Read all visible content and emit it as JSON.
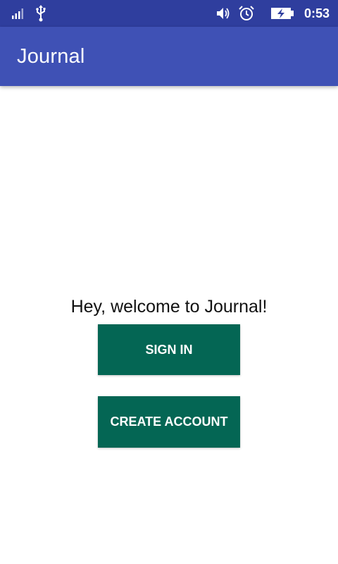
{
  "status_bar": {
    "time": "0:53",
    "icons": [
      "signal-icon",
      "usb-icon",
      "volume-icon",
      "alarm-icon",
      "battery-charging-icon"
    ],
    "background_color": "#2f3e9e"
  },
  "app_bar": {
    "title": "Journal",
    "background_color": "#3f51b5"
  },
  "main": {
    "welcome_text": "Hey, welcome to Journal!",
    "sign_in_label": "SIGN IN",
    "create_account_label": "CREATE ACCOUNT",
    "button_color": "#046654"
  }
}
